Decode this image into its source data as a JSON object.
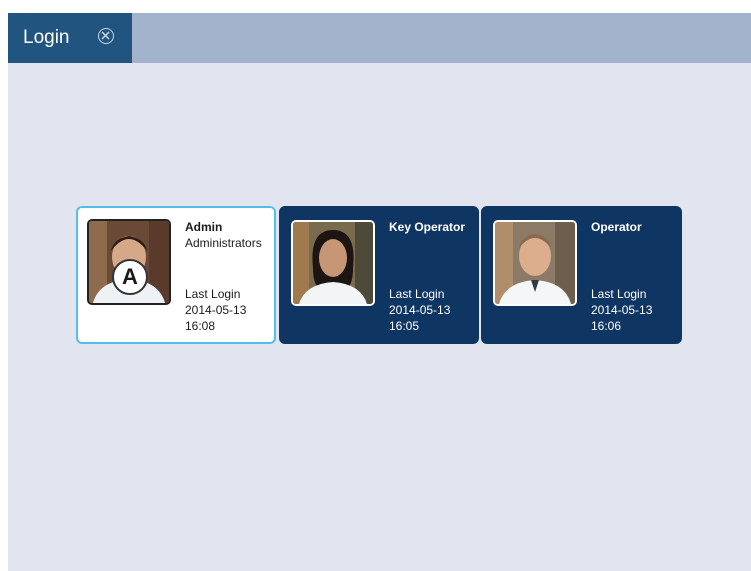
{
  "tab": {
    "title": "Login",
    "close_icon": "close-circle-icon"
  },
  "users": [
    {
      "name": "Admin",
      "group": "Administrators",
      "last_login_label": "Last Login",
      "date": "2014-05-13",
      "time": "16:08",
      "selected": true
    },
    {
      "name": "Key Operator",
      "group": "",
      "last_login_label": "Last Login",
      "date": "2014-05-13",
      "time": "16:05",
      "selected": false
    },
    {
      "name": "Operator",
      "group": "",
      "last_login_label": "Last Login",
      "date": "2014-05-13",
      "time": "16:06",
      "selected": false
    }
  ],
  "callout": {
    "label": "A"
  },
  "colors": {
    "tab_active": "#21557f",
    "tab_bar": "#a2b3cb",
    "background": "#e2e4ef",
    "card_dark": "#0f3562",
    "selected_border": "#52bfe8"
  }
}
